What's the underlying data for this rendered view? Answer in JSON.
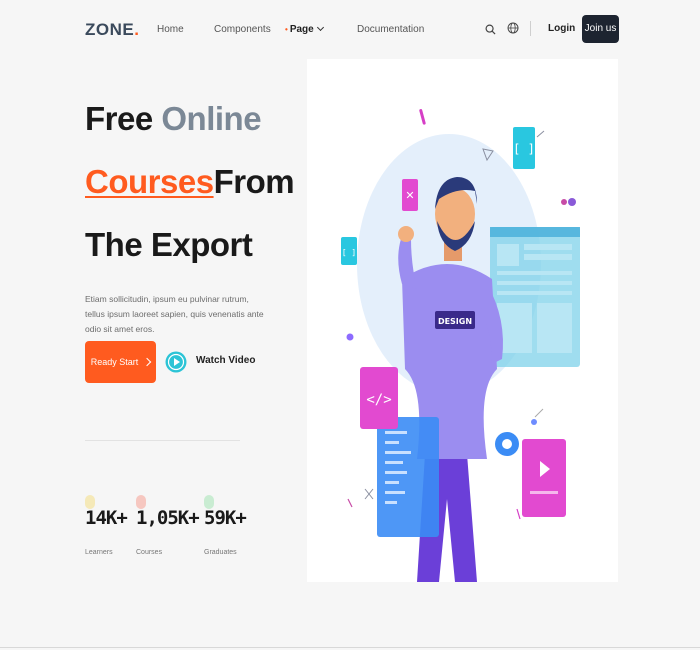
{
  "nav": {
    "logo": "ZONE",
    "logo_dot": ".",
    "links": [
      "Home",
      "Components",
      "Page",
      "Documentation"
    ],
    "page_marker": "•",
    "login_label": "Login",
    "join_label": "Join us"
  },
  "hero": {
    "line1_a": "Free ",
    "line1_b": "Online",
    "line2_a": "Courses",
    "line2_b": "From",
    "line3": "The Export",
    "description": "Etiam sollicitudin, ipsum eu pulvinar rutrum, tellus ipsum laoreet sapien, quis venenatis ante odio sit amet eros.",
    "ready_label": "Ready Start",
    "watch_label": "Watch Video"
  },
  "stats": [
    {
      "value": "14K+",
      "label": "Learners",
      "color": "#f5e9b8"
    },
    {
      "value": "1,05K+",
      "label": "Courses",
      "color": "#f6c7c0"
    },
    {
      "value": "59K+",
      "label": "Graduates",
      "color": "#c9ecd2"
    }
  ],
  "illustration": {
    "badge_text": "DESIGN",
    "code_symbol": "</>",
    "bracket_symbol": "[ ]",
    "x_symbol": "✕"
  },
  "colors": {
    "accent": "#ff5b1f",
    "dark": "#1d2430",
    "muted": "#7b8896"
  }
}
